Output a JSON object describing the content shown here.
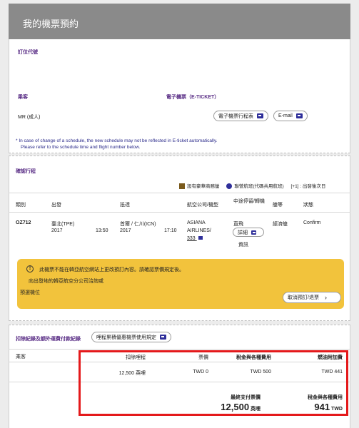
{
  "header": {
    "title": "我的機票預約"
  },
  "booking": {
    "label": "訂位代號"
  },
  "passenger": {
    "label": "乘客",
    "name": "MR (成人)",
    "eticket_label": "電子機票（E-TICKET）",
    "itinerary_btn": "電子機票行程表",
    "email_btn": "E-mail"
  },
  "notice": {
    "line1": "* In case of change of a schedule, the new schedule may not be reflected in E-ticket automatically.",
    "line2": "Please refer to the schedule time and flight number below."
  },
  "itinerary": {
    "label": "確認行程",
    "legend_first": "設有豪華商務艙",
    "legend_codeshare": "聯營航班(代碼共用航班)",
    "legend_next": "[+1] : 出發後次日",
    "columns": [
      "類別",
      "出發",
      "抵達",
      "航空公司/機型",
      "中途停留/轉機",
      "艙等",
      "狀態"
    ],
    "flight": {
      "class": "OZ712",
      "dep_city": "臺北(TPE)",
      "dep_year": "2017",
      "dep_time": "13:50",
      "arr_city": "首爾 / 仁川(ICN)",
      "arr_year": "2017",
      "arr_time": "17:10",
      "airline1": "ASIANA",
      "airline2": "AIRLINES/",
      "airline3": "333",
      "stop": "直飛",
      "detail_btn": "詳細",
      "info_link": "資訊",
      "cabin": "經濟艙",
      "status": "Confirm"
    }
  },
  "warning": {
    "line1": "此機票不能在韓亞航空網站上更改預訂內容。請確認票價規定後。",
    "line2": "向出發地的韓亞航空分公司洽詢或",
    "line3": "預選機位",
    "cancel_btn": "取消預訂/退票"
  },
  "payment": {
    "label": "扣除紀錄及額外運費付款紀錄",
    "rule_btn": "哩程累積優惠機票使用規定",
    "passenger_col": "乘客",
    "columns": [
      "扣除哩程",
      "票價",
      "稅金與各種費用",
      "燃油附加費"
    ],
    "values": [
      "12,500 英哩",
      "TWD 0",
      "TWD 500",
      "TWD 441"
    ],
    "total_label": "最終支付票價",
    "total_value": "12,500",
    "total_unit": "英哩",
    "tax_label": "稅金與各種費用",
    "tax_value": "941",
    "tax_unit": "TWD"
  },
  "colors": {
    "accent": "#5a2e86",
    "warning": "#f2c33c",
    "highlight": "#e4191b"
  }
}
